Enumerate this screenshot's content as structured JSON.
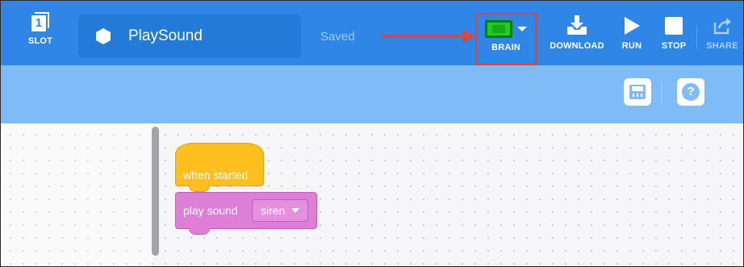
{
  "toolbar": {
    "slot": {
      "number": "1",
      "label": "SLOT",
      "icon": "slot-icon"
    },
    "project": {
      "name": "PlaySound",
      "icon": "hexagon-icon"
    },
    "save_status": "Saved",
    "brain": {
      "label": "BRAIN",
      "icon": "brain-icon"
    },
    "download": {
      "label": "DOWNLOAD",
      "icon": "download-icon"
    },
    "run": {
      "label": "RUN",
      "icon": "play-icon"
    },
    "stop": {
      "label": "STOP",
      "icon": "stop-icon"
    },
    "share": {
      "label": "SHARE",
      "icon": "share-icon"
    }
  },
  "subbar": {
    "device_icon": "device-info-icon",
    "help_text": "?",
    "help_icon": "help-icon"
  },
  "workspace": {
    "blocks": [
      {
        "type": "hat",
        "text": "when started",
        "color": "#ffbf1f"
      },
      {
        "type": "command",
        "text": "play sound",
        "dropdown_value": "siren",
        "color": "#de7fd7"
      }
    ]
  },
  "annotations": {
    "arrow_color": "#e0433b",
    "highlight_color": "#e0433b"
  },
  "colors": {
    "toolbar_bg": "#2f86e6",
    "subbar_bg": "#7fbcf7"
  }
}
